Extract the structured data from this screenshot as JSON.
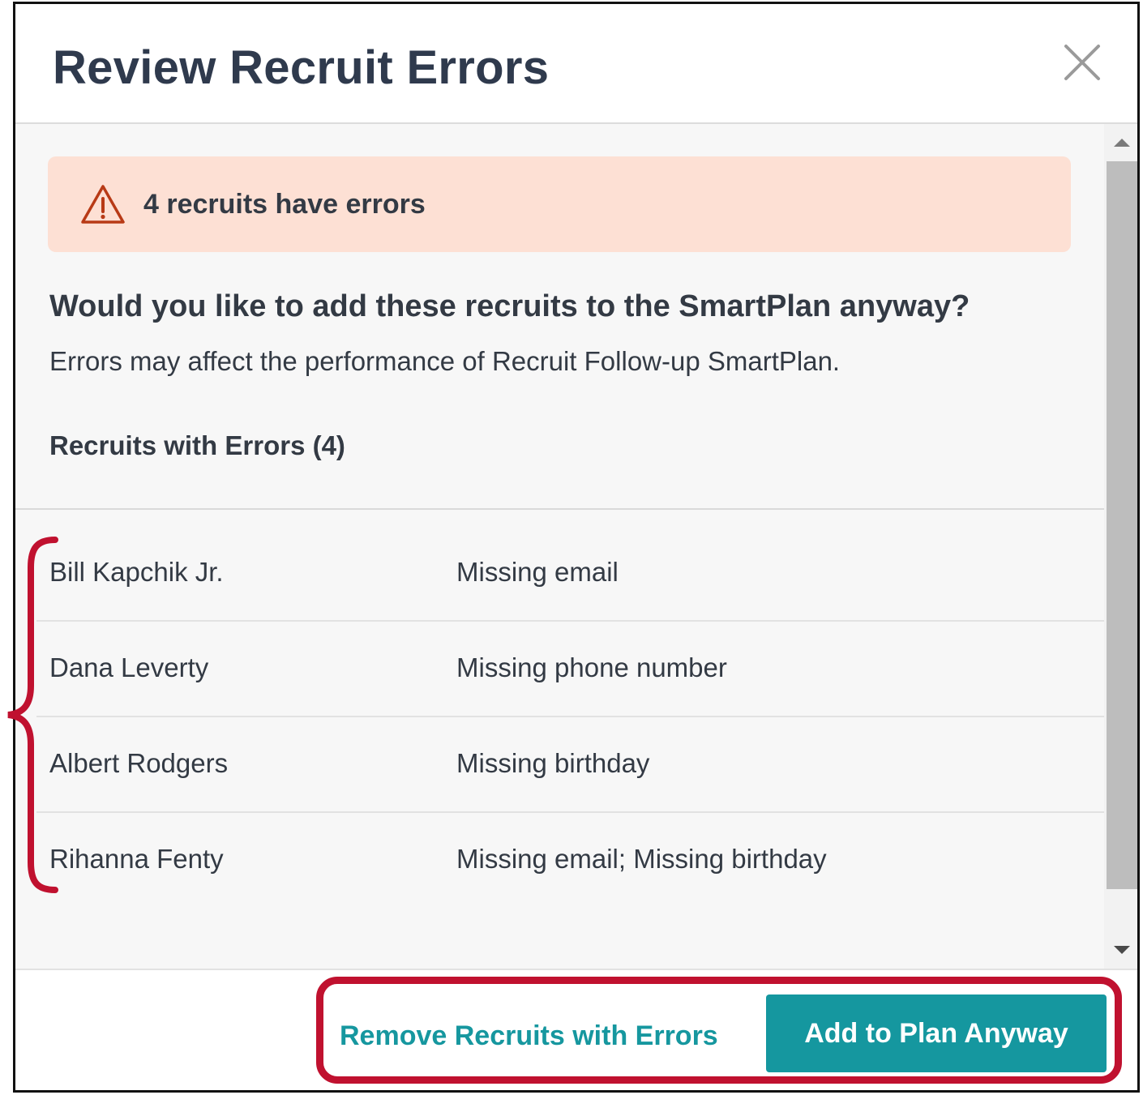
{
  "dialog": {
    "title": "Review Recruit Errors",
    "close_icon": "close-icon"
  },
  "alert": {
    "icon": "warning-triangle-icon",
    "message": "4 recruits have errors",
    "background_color": "#fde0d4",
    "icon_color": "#b83a16"
  },
  "question": "Would you like to add these recruits to the SmartPlan anyway?",
  "subtext": "Errors may affect the performance of Recruit Follow-up SmartPlan.",
  "list_heading": "Recruits with Errors (4)",
  "recruits": [
    {
      "name": "Bill Kapchik Jr.",
      "error": "Missing email"
    },
    {
      "name": "Dana Leverty",
      "error": "Missing phone number"
    },
    {
      "name": "Albert Rodgers",
      "error": "Missing birthday"
    },
    {
      "name": "Rihanna Fenty",
      "error": "Missing email; Missing birthday"
    }
  ],
  "footer": {
    "remove_label": "Remove Recruits with Errors",
    "add_label": "Add to Plan Anyway"
  },
  "colors": {
    "title_text": "#2f3a4d",
    "body_text": "#333a44",
    "accent": "#15979f",
    "annotation": "#c0112f"
  }
}
